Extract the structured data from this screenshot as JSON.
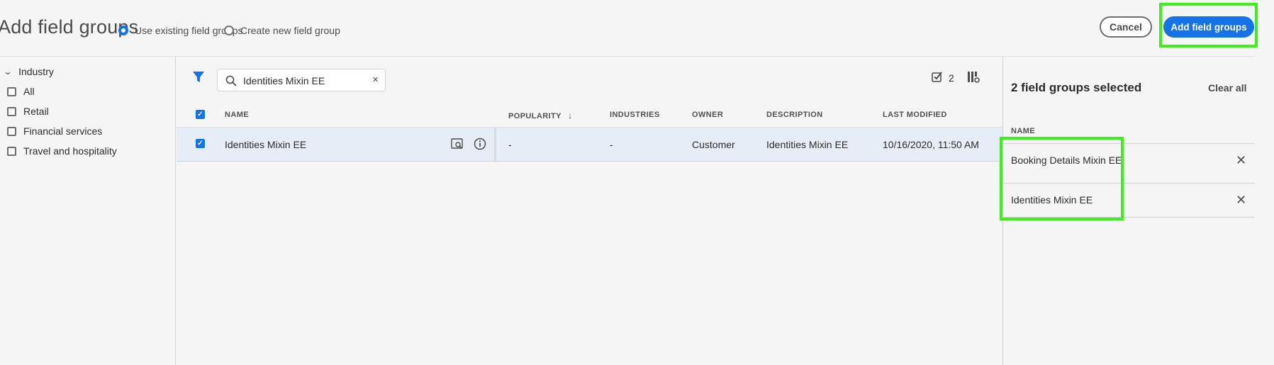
{
  "header": {
    "title": "Add field groups",
    "radio_existing": "Use existing field groups",
    "radio_new": "Create new field group",
    "cancel_label": "Cancel",
    "add_label": "Add field groups"
  },
  "filters": {
    "heading": "Industry",
    "items": [
      {
        "label": "All",
        "checked": false
      },
      {
        "label": "Retail",
        "checked": false
      },
      {
        "label": "Financial services",
        "checked": false
      },
      {
        "label": "Travel and hospitality",
        "checked": false
      }
    ]
  },
  "toolbar": {
    "search_value": "Identities Mixin EE",
    "selected_count": "2"
  },
  "table": {
    "columns": {
      "name": "NAME",
      "popularity": "POPULARITY",
      "industries": "INDUSTRIES",
      "owner": "OWNER",
      "description": "DESCRIPTION",
      "last_modified": "LAST MODIFIED"
    },
    "rows": [
      {
        "name": "Identities Mixin EE",
        "popularity": "-",
        "industries": "-",
        "owner": "Customer",
        "description": "Identities Mixin EE",
        "last_modified": "10/16/2020, 11:50 AM",
        "checked": true
      }
    ]
  },
  "selection": {
    "title": "2 field groups selected",
    "clear_label": "Clear all",
    "column": "NAME",
    "items": [
      "Booking Details Mixin EE",
      "Identities Mixin EE"
    ]
  },
  "colors": {
    "accent": "#1473e6",
    "highlight": "#3ef019",
    "selected_row": "#e6edf6"
  }
}
